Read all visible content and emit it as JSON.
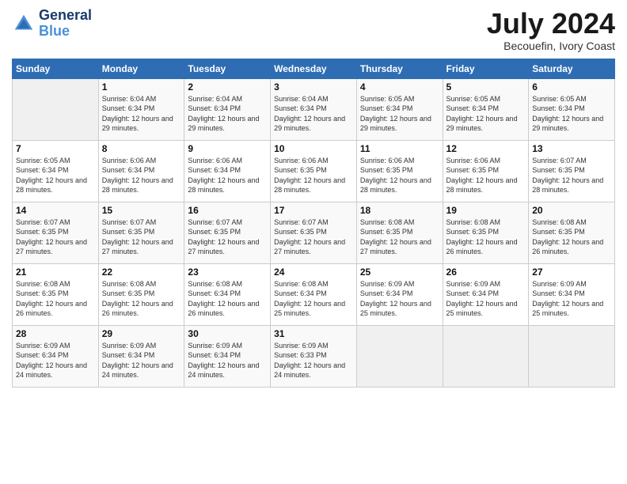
{
  "logo": {
    "line1": "General",
    "line2": "Blue"
  },
  "header": {
    "month_year": "July 2024",
    "location": "Becouefin, Ivory Coast"
  },
  "days_of_week": [
    "Sunday",
    "Monday",
    "Tuesday",
    "Wednesday",
    "Thursday",
    "Friday",
    "Saturday"
  ],
  "weeks": [
    [
      {
        "num": "",
        "sunrise": "",
        "sunset": "",
        "daylight": ""
      },
      {
        "num": "1",
        "sunrise": "Sunrise: 6:04 AM",
        "sunset": "Sunset: 6:34 PM",
        "daylight": "Daylight: 12 hours and 29 minutes."
      },
      {
        "num": "2",
        "sunrise": "Sunrise: 6:04 AM",
        "sunset": "Sunset: 6:34 PM",
        "daylight": "Daylight: 12 hours and 29 minutes."
      },
      {
        "num": "3",
        "sunrise": "Sunrise: 6:04 AM",
        "sunset": "Sunset: 6:34 PM",
        "daylight": "Daylight: 12 hours and 29 minutes."
      },
      {
        "num": "4",
        "sunrise": "Sunrise: 6:05 AM",
        "sunset": "Sunset: 6:34 PM",
        "daylight": "Daylight: 12 hours and 29 minutes."
      },
      {
        "num": "5",
        "sunrise": "Sunrise: 6:05 AM",
        "sunset": "Sunset: 6:34 PM",
        "daylight": "Daylight: 12 hours and 29 minutes."
      },
      {
        "num": "6",
        "sunrise": "Sunrise: 6:05 AM",
        "sunset": "Sunset: 6:34 PM",
        "daylight": "Daylight: 12 hours and 29 minutes."
      }
    ],
    [
      {
        "num": "7",
        "sunrise": "Sunrise: 6:05 AM",
        "sunset": "Sunset: 6:34 PM",
        "daylight": "Daylight: 12 hours and 28 minutes."
      },
      {
        "num": "8",
        "sunrise": "Sunrise: 6:06 AM",
        "sunset": "Sunset: 6:34 PM",
        "daylight": "Daylight: 12 hours and 28 minutes."
      },
      {
        "num": "9",
        "sunrise": "Sunrise: 6:06 AM",
        "sunset": "Sunset: 6:34 PM",
        "daylight": "Daylight: 12 hours and 28 minutes."
      },
      {
        "num": "10",
        "sunrise": "Sunrise: 6:06 AM",
        "sunset": "Sunset: 6:35 PM",
        "daylight": "Daylight: 12 hours and 28 minutes."
      },
      {
        "num": "11",
        "sunrise": "Sunrise: 6:06 AM",
        "sunset": "Sunset: 6:35 PM",
        "daylight": "Daylight: 12 hours and 28 minutes."
      },
      {
        "num": "12",
        "sunrise": "Sunrise: 6:06 AM",
        "sunset": "Sunset: 6:35 PM",
        "daylight": "Daylight: 12 hours and 28 minutes."
      },
      {
        "num": "13",
        "sunrise": "Sunrise: 6:07 AM",
        "sunset": "Sunset: 6:35 PM",
        "daylight": "Daylight: 12 hours and 28 minutes."
      }
    ],
    [
      {
        "num": "14",
        "sunrise": "Sunrise: 6:07 AM",
        "sunset": "Sunset: 6:35 PM",
        "daylight": "Daylight: 12 hours and 27 minutes."
      },
      {
        "num": "15",
        "sunrise": "Sunrise: 6:07 AM",
        "sunset": "Sunset: 6:35 PM",
        "daylight": "Daylight: 12 hours and 27 minutes."
      },
      {
        "num": "16",
        "sunrise": "Sunrise: 6:07 AM",
        "sunset": "Sunset: 6:35 PM",
        "daylight": "Daylight: 12 hours and 27 minutes."
      },
      {
        "num": "17",
        "sunrise": "Sunrise: 6:07 AM",
        "sunset": "Sunset: 6:35 PM",
        "daylight": "Daylight: 12 hours and 27 minutes."
      },
      {
        "num": "18",
        "sunrise": "Sunrise: 6:08 AM",
        "sunset": "Sunset: 6:35 PM",
        "daylight": "Daylight: 12 hours and 27 minutes."
      },
      {
        "num": "19",
        "sunrise": "Sunrise: 6:08 AM",
        "sunset": "Sunset: 6:35 PM",
        "daylight": "Daylight: 12 hours and 26 minutes."
      },
      {
        "num": "20",
        "sunrise": "Sunrise: 6:08 AM",
        "sunset": "Sunset: 6:35 PM",
        "daylight": "Daylight: 12 hours and 26 minutes."
      }
    ],
    [
      {
        "num": "21",
        "sunrise": "Sunrise: 6:08 AM",
        "sunset": "Sunset: 6:35 PM",
        "daylight": "Daylight: 12 hours and 26 minutes."
      },
      {
        "num": "22",
        "sunrise": "Sunrise: 6:08 AM",
        "sunset": "Sunset: 6:35 PM",
        "daylight": "Daylight: 12 hours and 26 minutes."
      },
      {
        "num": "23",
        "sunrise": "Sunrise: 6:08 AM",
        "sunset": "Sunset: 6:34 PM",
        "daylight": "Daylight: 12 hours and 26 minutes."
      },
      {
        "num": "24",
        "sunrise": "Sunrise: 6:08 AM",
        "sunset": "Sunset: 6:34 PM",
        "daylight": "Daylight: 12 hours and 25 minutes."
      },
      {
        "num": "25",
        "sunrise": "Sunrise: 6:09 AM",
        "sunset": "Sunset: 6:34 PM",
        "daylight": "Daylight: 12 hours and 25 minutes."
      },
      {
        "num": "26",
        "sunrise": "Sunrise: 6:09 AM",
        "sunset": "Sunset: 6:34 PM",
        "daylight": "Daylight: 12 hours and 25 minutes."
      },
      {
        "num": "27",
        "sunrise": "Sunrise: 6:09 AM",
        "sunset": "Sunset: 6:34 PM",
        "daylight": "Daylight: 12 hours and 25 minutes."
      }
    ],
    [
      {
        "num": "28",
        "sunrise": "Sunrise: 6:09 AM",
        "sunset": "Sunset: 6:34 PM",
        "daylight": "Daylight: 12 hours and 24 minutes."
      },
      {
        "num": "29",
        "sunrise": "Sunrise: 6:09 AM",
        "sunset": "Sunset: 6:34 PM",
        "daylight": "Daylight: 12 hours and 24 minutes."
      },
      {
        "num": "30",
        "sunrise": "Sunrise: 6:09 AM",
        "sunset": "Sunset: 6:34 PM",
        "daylight": "Daylight: 12 hours and 24 minutes."
      },
      {
        "num": "31",
        "sunrise": "Sunrise: 6:09 AM",
        "sunset": "Sunset: 6:33 PM",
        "daylight": "Daylight: 12 hours and 24 minutes."
      },
      {
        "num": "",
        "sunrise": "",
        "sunset": "",
        "daylight": ""
      },
      {
        "num": "",
        "sunrise": "",
        "sunset": "",
        "daylight": ""
      },
      {
        "num": "",
        "sunrise": "",
        "sunset": "",
        "daylight": ""
      }
    ]
  ]
}
